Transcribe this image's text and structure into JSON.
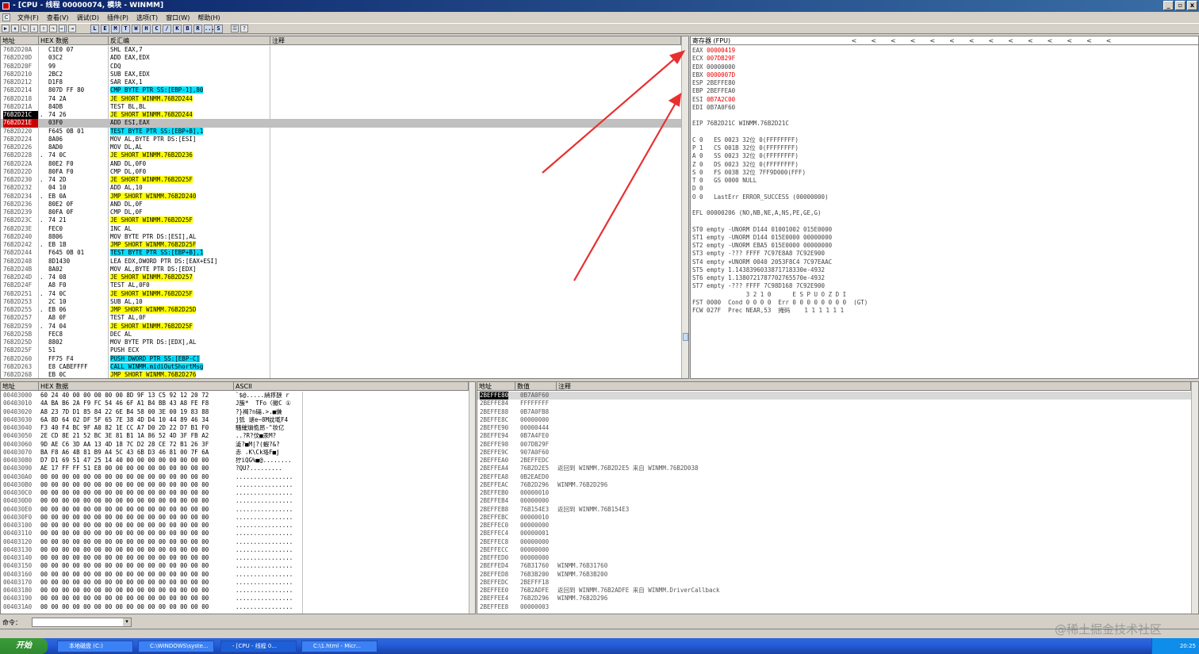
{
  "window": {
    "title": "- [CPU - 线程 00000074, 模块 - WINMM]",
    "buttons": [
      "_",
      "▫",
      "x"
    ]
  },
  "menu": [
    "文件(F)",
    "查看(V)",
    "调试(D)",
    "插件(P)",
    "选项(T)",
    "窗口(W)",
    "帮助(H)"
  ],
  "toolbar": {
    "buttons": [
      "▶",
      "⏸",
      "↳",
      "↓",
      "↑",
      "↷",
      "→|",
      "⇥"
    ],
    "letters": [
      "L",
      "E",
      "M",
      "T",
      "W",
      "H",
      "C",
      "/",
      "K",
      "B",
      "R",
      "...",
      "S",
      "☰",
      "?"
    ]
  },
  "disasm": {
    "headers": [
      "地址",
      "HEX 数据",
      "反汇编",
      "注释"
    ],
    "rows": [
      [
        "76B2D20A",
        "",
        "C1E0 07",
        "SHL EAX,7",
        ""
      ],
      [
        "76B2D20D",
        "",
        "03C2",
        "ADD EAX,EDX",
        ""
      ],
      [
        "76B2D20F",
        "",
        "99",
        "CDQ",
        ""
      ],
      [
        "76B2D210",
        "",
        "2BC2",
        "SUB EAX,EDX",
        ""
      ],
      [
        "76B2D212",
        "",
        "D1F8",
        "SAR EAX,1",
        ""
      ],
      [
        "76B2D214",
        "",
        "807D FF 80",
        "CMP BYTE PTR SS:[EBP-1],80",
        "c"
      ],
      [
        "76B2D218",
        "",
        "74 2A",
        "JE SHORT WINMM.76B2D244",
        "y"
      ],
      [
        "76B2D21A",
        "",
        "84DB",
        "TEST BL,BL",
        ""
      ],
      [
        "76B2D21C",
        ".",
        "74 26",
        "JE SHORT WINMM.76B2D244",
        "y"
      ],
      [
        "76B2D21E",
        "",
        "03F0",
        "ADD ESI,EAX",
        ""
      ],
      [
        "76B2D220",
        "",
        "F645 0B 01",
        "TEST BYTE PTR SS:[EBP+B],1",
        "c"
      ],
      [
        "76B2D224",
        "",
        "8A06",
        "MOV AL,BYTE PTR DS:[ESI]",
        ""
      ],
      [
        "76B2D226",
        "",
        "8AD0",
        "MOV DL,AL",
        ""
      ],
      [
        "76B2D228",
        ".",
        "74 0C",
        "JE SHORT WINMM.76B2D236",
        "y"
      ],
      [
        "76B2D22A",
        "",
        "80E2 F0",
        "AND DL,0F0",
        ""
      ],
      [
        "76B2D22D",
        "",
        "80FA F0",
        "CMP DL,0F0",
        ""
      ],
      [
        "76B2D230",
        ".",
        "74 2D",
        "JE SHORT WINMM.76B2D25F",
        "y"
      ],
      [
        "76B2D232",
        "",
        "04 10",
        "ADD AL,10",
        ""
      ],
      [
        "76B2D234",
        ".",
        "EB 0A",
        "JMP SHORT WINMM.76B2D240",
        "y"
      ],
      [
        "76B2D236",
        "",
        "80E2 0F",
        "AND DL,0F",
        ""
      ],
      [
        "76B2D239",
        "",
        "80FA 0F",
        "CMP DL,0F",
        ""
      ],
      [
        "76B2D23C",
        ".",
        "74 21",
        "JE SHORT WINMM.76B2D25F",
        "y"
      ],
      [
        "76B2D23E",
        "",
        "FEC0",
        "INC AL",
        ""
      ],
      [
        "76B2D240",
        "",
        "8806",
        "MOV BYTE PTR DS:[ESI],AL",
        ""
      ],
      [
        "76B2D242",
        ".",
        "EB 1B",
        "JMP SHORT WINMM.76B2D25F",
        "y"
      ],
      [
        "76B2D244",
        "",
        "F645 0B 01",
        "TEST BYTE PTR SS:[EBP+B],1",
        "c"
      ],
      [
        "76B2D248",
        "",
        "8D1430",
        "LEA EDX,DWORD PTR DS:[EAX+ESI]",
        ""
      ],
      [
        "76B2D24B",
        "",
        "8A02",
        "MOV AL,BYTE PTR DS:[EDX]",
        ""
      ],
      [
        "76B2D24D",
        ".",
        "74 08",
        "JE SHORT WINMM.76B2D257",
        "y"
      ],
      [
        "76B2D24F",
        "",
        "A8 F0",
        "TEST AL,0F0",
        ""
      ],
      [
        "76B2D251",
        ".",
        "74 0C",
        "JE SHORT WINMM.76B2D25F",
        "y"
      ],
      [
        "76B2D253",
        "",
        "2C 10",
        "SUB AL,10",
        ""
      ],
      [
        "76B2D255",
        ".",
        "EB 06",
        "JMP SHORT WINMM.76B2D25D",
        "y"
      ],
      [
        "76B2D257",
        "",
        "A8 0F",
        "TEST AL,0F",
        ""
      ],
      [
        "76B2D259",
        ".",
        "74 04",
        "JE SHORT WINMM.76B2D25F",
        "y"
      ],
      [
        "76B2D25B",
        "",
        "FEC8",
        "DEC AL",
        ""
      ],
      [
        "76B2D25D",
        "",
        "8802",
        "MOV BYTE PTR DS:[EDX],AL",
        ""
      ],
      [
        "76B2D25F",
        "",
        "51",
        "PUSH ECX",
        ""
      ],
      [
        "76B2D260",
        "",
        "FF75 F4",
        "PUSH DWORD PTR SS:[EBP-C]",
        "c"
      ],
      [
        "76B2D263",
        "",
        "E8 CABEFFFF",
        "CALL WINMM.midiOutShortMsg",
        "c"
      ],
      [
        "76B2D268",
        "",
        "EB 0C",
        "JMP SHORT WINMM.76B2D276",
        "y"
      ]
    ]
  },
  "registers": {
    "header": "寄存器 (FPU)",
    "lines": [
      {
        "t": "EAX 00000419",
        "r": true
      },
      {
        "t": "ECX 007DB29F",
        "r": true
      },
      {
        "t": "EDX 00000000",
        "r": false
      },
      {
        "t": "EBX 0000007D",
        "r": true
      },
      {
        "t": "ESP 2BEFFE80",
        "r": false
      },
      {
        "t": "EBP 2BEFFEA0",
        "r": false
      },
      {
        "t": "ESI 0B7A2C00",
        "r": true
      },
      {
        "t": "EDI 0B7A0F60",
        "r": false
      },
      {
        "t": "",
        "r": false
      },
      {
        "t": "EIP 76B2D21C WINMM.76B2D21C",
        "r": false
      },
      {
        "t": "",
        "r": false
      },
      {
        "t": "C 0   ES 0023 32位 0(FFFFFFFF)",
        "r": false
      },
      {
        "t": "P 1   CS 001B 32位 0(FFFFFFFF)",
        "r": false
      },
      {
        "t": "A 0   SS 0023 32位 0(FFFFFFFF)",
        "r": false
      },
      {
        "t": "Z 0   DS 0023 32位 0(FFFFFFFF)",
        "r": false
      },
      {
        "t": "S 0   FS 003B 32位 7FF9D000(FFF)",
        "r": false
      },
      {
        "t": "T 0   GS 0000 NULL",
        "r": false
      },
      {
        "t": "D 0",
        "r": false
      },
      {
        "t": "O 0   LastErr ERROR_SUCCESS (00000000)",
        "r": false
      },
      {
        "t": "",
        "r": false
      },
      {
        "t": "EFL 00000206 (NO,NB,NE,A,NS,PE,GE,G)",
        "r": false
      },
      {
        "t": "",
        "r": false
      },
      {
        "t": "ST0 empty -UNORM D144 01001002 015E0000",
        "r": false
      },
      {
        "t": "ST1 empty -UNORM D144 015E0000 00000000",
        "r": false
      },
      {
        "t": "ST2 empty -UNORM EBA5 015E0000 00000000",
        "r": false
      },
      {
        "t": "ST3 empty -??? FFFF 7C97E8A8 7C92E900",
        "r": false
      },
      {
        "t": "ST4 empty +UNORM 0040 2053F8C4 7C97EAAC",
        "r": false
      },
      {
        "t": "ST5 empty 1.1438396033871718330e-4932",
        "r": false
      },
      {
        "t": "ST6 empty 1.1380721787702765570e-4932",
        "r": false
      },
      {
        "t": "ST7 empty -??? FFFF 7C98D168 7C92E900",
        "r": false
      },
      {
        "t": "               3 2 1 0      E S P U O Z D I",
        "r": false
      },
      {
        "t": "FST 0000  Cond 0 0 0 0  Err 0 0 0 0 0 0 0 0  (GT)",
        "r": false
      },
      {
        "t": "FCW 027F  Prec NEAR,53  掩码    1 1 1 1 1 1",
        "r": false
      }
    ]
  },
  "dump": {
    "headers": [
      "地址",
      "HEX 数据",
      "ASCII"
    ],
    "rows": [
      [
        "00403000",
        "60 24 40 00 00 00 00 00 8D 9F 13 C5 92 12 20 72",
        "`$@.....綃捊斔 r"
      ],
      [
        "00403010",
        "4A BA B6 2A F9 FC 54 46 6F A1 B4 BB 43 A8 FE F8",
        "J簇*  TFo〈徽C ①"
      ],
      [
        "00403020",
        "A8 23 7D D1 85 84 22 6E B4 58 00 3E 00 19 83 88",
        "?}褐?n碭.>.■傔"
      ],
      [
        "00403030",
        "6A 8D 64 02 DF 5F 65 7E 38 4D D4 10 44 89 46 34",
        "j弤 遚e~8M訦墘F4"
      ],
      [
        "00403040",
        "F3 40 F4 BC 9F A0 82 1E CC A7 D0 2D 22 D7 B1 F0",
        "騷繀熉佹昂-\"妆亿"
      ],
      [
        "00403050",
        "2E CD 8E 21 52 BC 3E 81 B1 1A 86 52 4D 3F FB A2",
        "..?R?伩■汞M?"
      ],
      [
        "00403060",
        "9D AE C6 3D AA 13 4D 18 7C D2 28 CE 72 B1 26 3F",
        "澁?■M|?(蝦?&?"
      ],
      [
        "00403070",
        "BA F8 A6 4B 81 B9 A4 5C 43 6B D3 46 81 00 7F 6A",
        "赤 ،K\\Ck珞F■j"
      ],
      [
        "00403080",
        "D7 D1 69 51 47 25 14 40 00 00 00 00 00 00 00 00",
        "狞iQG%■@........"
      ],
      [
        "00403090",
        "AE 17 FF FF 51 E8 00 00 00 00 00 00 00 00 00 00",
        "?QU?........."
      ],
      [
        "004030A0",
        "00 00 00 00 00 00 00 00 00 00 00 00 00 00 00 00",
        "................"
      ],
      [
        "004030B0",
        "00 00 00 00 00 00 00 00 00 00 00 00 00 00 00 00",
        "................"
      ],
      [
        "004030C0",
        "00 00 00 00 00 00 00 00 00 00 00 00 00 00 00 00",
        "................"
      ],
      [
        "004030D0",
        "00 00 00 00 00 00 00 00 00 00 00 00 00 00 00 00",
        "................"
      ],
      [
        "004030E0",
        "00 00 00 00 00 00 00 00 00 00 00 00 00 00 00 00",
        "................"
      ],
      [
        "004030F0",
        "00 00 00 00 00 00 00 00 00 00 00 00 00 00 00 00",
        "................"
      ],
      [
        "00403100",
        "00 00 00 00 00 00 00 00 00 00 00 00 00 00 00 00",
        "................"
      ],
      [
        "00403110",
        "00 00 00 00 00 00 00 00 00 00 00 00 00 00 00 00",
        "................"
      ],
      [
        "00403120",
        "00 00 00 00 00 00 00 00 00 00 00 00 00 00 00 00",
        "................"
      ],
      [
        "00403130",
        "00 00 00 00 00 00 00 00 00 00 00 00 00 00 00 00",
        "................"
      ],
      [
        "00403140",
        "00 00 00 00 00 00 00 00 00 00 00 00 00 00 00 00",
        "................"
      ],
      [
        "00403150",
        "00 00 00 00 00 00 00 00 00 00 00 00 00 00 00 00",
        "................"
      ],
      [
        "00403160",
        "00 00 00 00 00 00 00 00 00 00 00 00 00 00 00 00",
        "................"
      ],
      [
        "00403170",
        "00 00 00 00 00 00 00 00 00 00 00 00 00 00 00 00",
        "................"
      ],
      [
        "00403180",
        "00 00 00 00 00 00 00 00 00 00 00 00 00 00 00 00",
        "................"
      ],
      [
        "00403190",
        "00 00 00 00 00 00 00 00 00 00 00 00 00 00 00 00",
        "................"
      ],
      [
        "004031A0",
        "00 00 00 00 00 00 00 00 00 00 00 00 00 00 00 00",
        "................"
      ]
    ]
  },
  "stack": {
    "headers": [
      "地址",
      "数值",
      "注释"
    ],
    "rows": [
      [
        "2BEFFE80",
        "0B7A0F60",
        ""
      ],
      [
        "2BEFFE84",
        "FFFFFFFF",
        ""
      ],
      [
        "2BEFFE88",
        "0B7A0FB8",
        ""
      ],
      [
        "2BEFFE8C",
        "00000000",
        ""
      ],
      [
        "2BEFFE90",
        "00000444",
        ""
      ],
      [
        "2BEFFE94",
        "0B7A4FE0",
        ""
      ],
      [
        "2BEFFE98",
        "007DB29F",
        ""
      ],
      [
        "2BEFFE9C",
        "907A0F60",
        ""
      ],
      [
        "2BEFFEA0",
        "2BEFFEDC",
        ""
      ],
      [
        "2BEFFEA4",
        "76B2D2E5",
        "返回到 WINMM.76B2D2E5 来自 WINMM.76B2D038"
      ],
      [
        "2BEFFEA8",
        "0B2EAED0",
        ""
      ],
      [
        "2BEFFEAC",
        "76B2D296",
        "WINMM.76B2D296"
      ],
      [
        "2BEFFEB0",
        "00000010",
        ""
      ],
      [
        "2BEFFEB4",
        "00000000",
        ""
      ],
      [
        "2BEFFEB8",
        "76B154E3",
        "返回到 WINMM.76B154E3"
      ],
      [
        "2BEFFEBC",
        "00000010",
        ""
      ],
      [
        "2BEFFEC0",
        "00000000",
        ""
      ],
      [
        "2BEFFEC4",
        "00000001",
        ""
      ],
      [
        "2BEFFEC8",
        "00000000",
        ""
      ],
      [
        "2BEFFECC",
        "00000000",
        ""
      ],
      [
        "2BEFFED0",
        "00000000",
        ""
      ],
      [
        "2BEFFED4",
        "76B31760",
        "WINMM.76B31760"
      ],
      [
        "2BEFFED8",
        "76B3B200",
        "WINMM.76B3B200"
      ],
      [
        "2BEFFEDC",
        "2BEFFF18",
        ""
      ],
      [
        "2BEFFEE0",
        "76B2ADFE",
        "返回到 WINMM.76B2ADFE 来自 WINMM.DriverCallback"
      ],
      [
        "2BEFFEE4",
        "76B2D296",
        "WINMM.76B2D296"
      ],
      [
        "2BEFFEE8",
        "00000003",
        ""
      ]
    ]
  },
  "command": {
    "label": "命令：",
    "value": ""
  },
  "taskbar": {
    "start": "开始",
    "items": [
      "本地磁盘 (C:)",
      "C:\\WINDOWS\\syste...",
      "- [CPU - 线程 0...",
      "C:\\1.html - Micr..."
    ],
    "time": "20:25"
  },
  "watermark": "@稀土掘金技术社区",
  "colors": {
    "red": "#e00000",
    "yellow": "#ffff00",
    "cyan": "#00e0ff",
    "arrow": "#e83030"
  }
}
